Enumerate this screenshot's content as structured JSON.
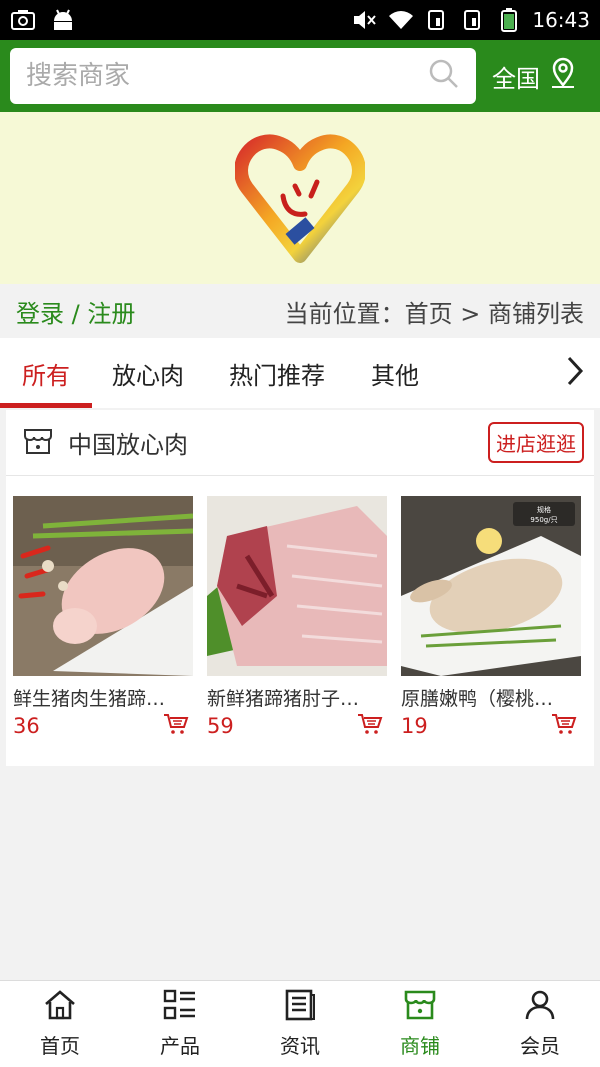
{
  "status_bar": {
    "time": "16:43"
  },
  "header": {
    "search_placeholder": "搜索商家",
    "region": "全国"
  },
  "location": {
    "login": "登录 / 注册",
    "breadcrumb": "当前位置：首页 > 商铺列表"
  },
  "tabs": [
    {
      "label": "所有",
      "active": true
    },
    {
      "label": "放心肉",
      "active": false
    },
    {
      "label": "热门推荐",
      "active": false
    },
    {
      "label": "其他",
      "active": false
    }
  ],
  "shop": {
    "name": "中国放心肉",
    "visit_label": "进店逛逛",
    "products": [
      {
        "title": "鲜生猪肉生猪蹄…",
        "price": "36"
      },
      {
        "title": "新鲜猪蹄猪肘子…",
        "price": "59"
      },
      {
        "title": "原膳嫩鸭（樱桃…",
        "price": "19",
        "badge_line1": "规格",
        "badge_line2": "950g/只"
      }
    ]
  },
  "bottom_nav": [
    {
      "label": "首页",
      "icon": "home-icon",
      "active": false
    },
    {
      "label": "产品",
      "icon": "grid-list-icon",
      "active": false
    },
    {
      "label": "资讯",
      "icon": "news-icon",
      "active": false
    },
    {
      "label": "商铺",
      "icon": "store-icon",
      "active": true
    },
    {
      "label": "会员",
      "icon": "user-icon",
      "active": false
    }
  ],
  "colors": {
    "brand_green": "#2a8a1c",
    "accent_red": "#cc1f1f",
    "banner_bg": "#f6f9d6"
  }
}
